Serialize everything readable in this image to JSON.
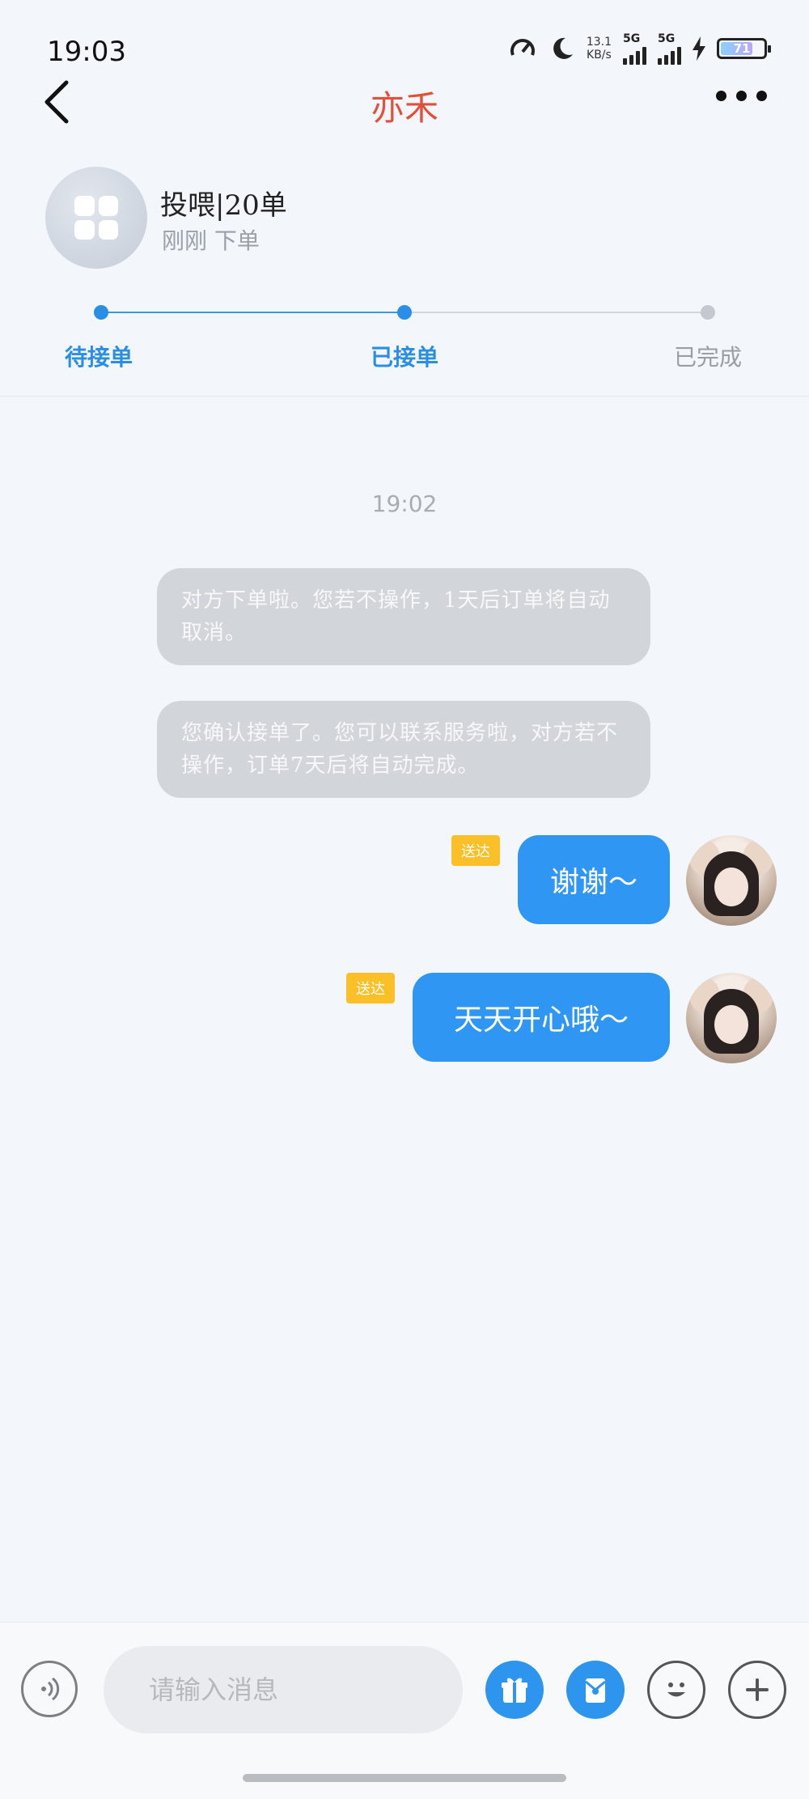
{
  "status_bar": {
    "time": "19:03",
    "net_speed_value": "13.1",
    "net_speed_unit": "KB/s",
    "signal_1": "5G",
    "signal_2": "5G",
    "battery": "71"
  },
  "header": {
    "title": "亦禾"
  },
  "order": {
    "title": "投喂|20单",
    "subtitle": "刚刚 下单"
  },
  "progress": {
    "steps": [
      {
        "label": "待接单",
        "color": "#2a8de6"
      },
      {
        "label": "已接单",
        "color": "#2a8de6"
      },
      {
        "label": "已完成",
        "color": "#9a9ea4"
      }
    ]
  },
  "chat": {
    "timestamp": "19:02",
    "system_messages": [
      "对方下单啦。您若不操作，1天后订单将自动取消。",
      "您确认接单了。您可以联系服务啦，对方若不操作，订单7天后将自动完成。"
    ],
    "messages": [
      {
        "tag": "送达",
        "text": "谢谢～"
      },
      {
        "tag": "送达",
        "text": "天天开心哦～"
      }
    ]
  },
  "composer": {
    "placeholder": "请输入消息"
  },
  "colors": {
    "accent": "#2f97f3",
    "title": "#e2503a",
    "tag": "#fbbf27"
  }
}
